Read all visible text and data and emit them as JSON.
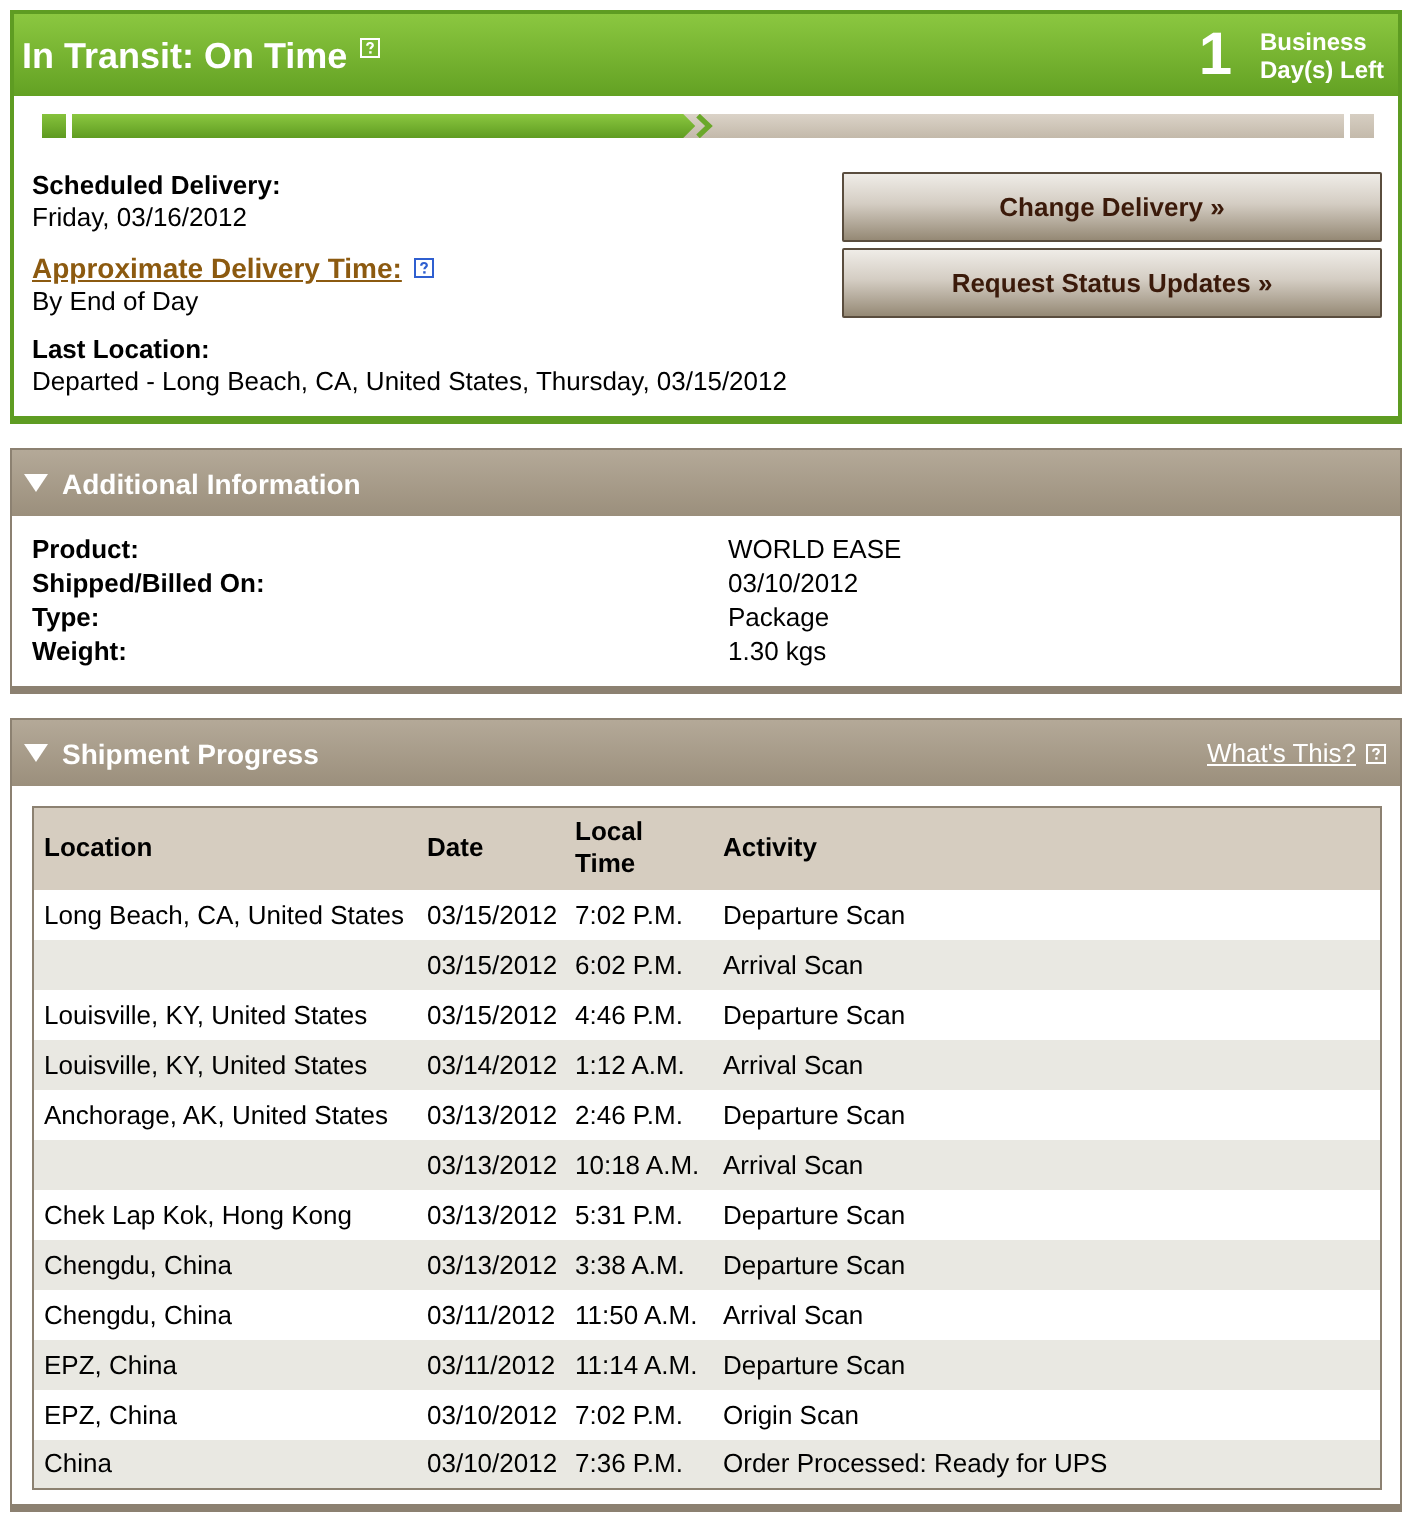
{
  "status": {
    "title": "In Transit: On Time",
    "days_count": "1",
    "days_label": "Business Day(s) Left",
    "progress": {
      "level": 0.49
    }
  },
  "delivery": {
    "fields": [
      {
        "kind": "text",
        "label": "Scheduled Delivery:",
        "value": "Friday, 03/16/2012"
      },
      {
        "kind": "link",
        "label": "Approximate Delivery Time:",
        "value": "By End of Day"
      },
      {
        "kind": "text",
        "label": "Last Location:",
        "value": "Departed - Long Beach, CA, United States, Thursday, 03/15/2012"
      }
    ],
    "buttons": [
      "Change Delivery »",
      "Request Status Updates »"
    ]
  },
  "additional_information": {
    "title": "Additional Information",
    "expanded": true,
    "rows": [
      {
        "label": "Product:",
        "value": "WORLD EASE"
      },
      {
        "label": "Shipped/Billed On:",
        "value": "03/10/2012"
      },
      {
        "label": "Type:",
        "value": "Package"
      },
      {
        "label": "Weight:",
        "value": "1.30 kgs"
      }
    ]
  },
  "shipment_progress": {
    "title": "Shipment Progress",
    "expanded": true,
    "link": "What's This?",
    "table": {
      "columns": [
        "Location",
        "Date",
        "Local Time",
        "Activity"
      ],
      "rows": [
        {
          "location": "Long Beach, CA, United States",
          "date": "03/15/2012",
          "local_time": "7:02 P.M.",
          "activity": "Departure Scan"
        },
        {
          "date": "03/15/2012",
          "local_time": "6:02 P.M.",
          "activity": "Arrival Scan"
        },
        {
          "location": "Louisville, KY, United States",
          "date": "03/15/2012",
          "local_time": "4:46 P.M.",
          "activity": "Departure Scan"
        },
        {
          "location": "Louisville, KY, United States",
          "date": "03/14/2012",
          "local_time": "1:12 A.M.",
          "activity": "Arrival Scan"
        },
        {
          "location": "Anchorage, AK, United States",
          "date": "03/13/2012",
          "local_time": "2:46 P.M.",
          "activity": "Departure Scan"
        },
        {
          "date": "03/13/2012",
          "local_time": "10:18 A.M.",
          "activity": "Arrival Scan"
        },
        {
          "location": "Chek Lap Kok, Hong Kong",
          "date": "03/13/2012",
          "local_time": "5:31 P.M.",
          "activity": "Departure Scan"
        },
        {
          "location": "Chengdu, China",
          "date": "03/13/2012",
          "local_time": "3:38 A.M.",
          "activity": "Departure Scan"
        },
        {
          "location": "Chengdu, China",
          "date": "03/11/2012",
          "local_time": "11:50 A.M.",
          "activity": "Arrival Scan"
        },
        {
          "location": "EPZ, China",
          "date": "03/11/2012",
          "local_time": "11:14 A.M.",
          "activity": "Departure Scan"
        },
        {
          "location": "EPZ, China",
          "date": "03/10/2012",
          "local_time": "7:02 P.M.",
          "activity": "Origin Scan"
        },
        {
          "location": "China",
          "date": "03/10/2012",
          "local_time": "7:36 P.M.",
          "activity": "Order Processed: Ready for UPS"
        }
      ]
    }
  }
}
